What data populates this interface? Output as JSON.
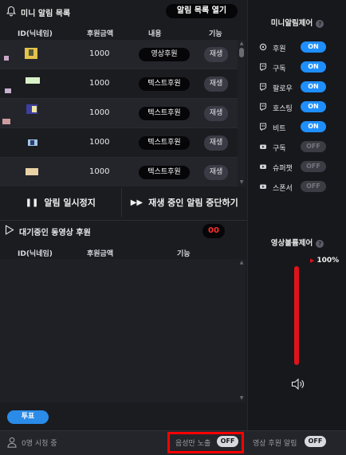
{
  "header": {
    "title": "미니 알림 목록",
    "open_list_label": "알림 목록 열기"
  },
  "alert_table": {
    "columns": [
      "ID(닉네임)",
      "후원금액",
      "내용",
      "기능"
    ],
    "rows": [
      {
        "amount": "1000",
        "type": "영상후원",
        "action": "재생"
      },
      {
        "amount": "1000",
        "type": "텍스트후원",
        "action": "재생"
      },
      {
        "amount": "1000",
        "type": "텍스트후원",
        "action": "재생"
      },
      {
        "amount": "1000",
        "type": "텍스트후원",
        "action": "재생"
      },
      {
        "amount": "1000",
        "type": "텍스트후원",
        "action": "재생"
      }
    ]
  },
  "controls": {
    "pause_label": "알림 일시정지",
    "stop_label": "재생 중인 알림 중단하기"
  },
  "queue": {
    "title": "대기중인 동영상 후원",
    "count": "00",
    "columns": [
      "ID(닉네임)",
      "후원금액",
      "기능"
    ]
  },
  "vote_label": "투표",
  "mini_alert_control": {
    "title": "미니알림제어",
    "items": [
      {
        "label": "후원",
        "state": "ON",
        "icon": "donation-icon"
      },
      {
        "label": "구독",
        "state": "ON",
        "icon": "twitch-icon"
      },
      {
        "label": "팔로우",
        "state": "ON",
        "icon": "twitch-icon"
      },
      {
        "label": "호스팅",
        "state": "ON",
        "icon": "twitch-icon"
      },
      {
        "label": "비트",
        "state": "ON",
        "icon": "twitch-icon"
      },
      {
        "label": "구독",
        "state": "OFF",
        "icon": "youtube-icon"
      },
      {
        "label": "슈퍼챗",
        "state": "OFF",
        "icon": "youtube-icon"
      },
      {
        "label": "스폰서",
        "state": "OFF",
        "icon": "youtube-icon"
      }
    ]
  },
  "volume_control": {
    "title": "영상볼륨제어",
    "level": "100%",
    "level_fraction": 1.0
  },
  "footer": {
    "viewer_text": "0명 시청 중",
    "audio_only_label": "음성만 노출",
    "audio_only_state": "OFF",
    "video_alert_label": "영상 후원 알림",
    "video_alert_state": "OFF"
  },
  "colors": {
    "on": "#1f8fff",
    "off": "#3b3c44",
    "accent_red": "#e0131a",
    "vote_blue": "#2a8be8"
  }
}
